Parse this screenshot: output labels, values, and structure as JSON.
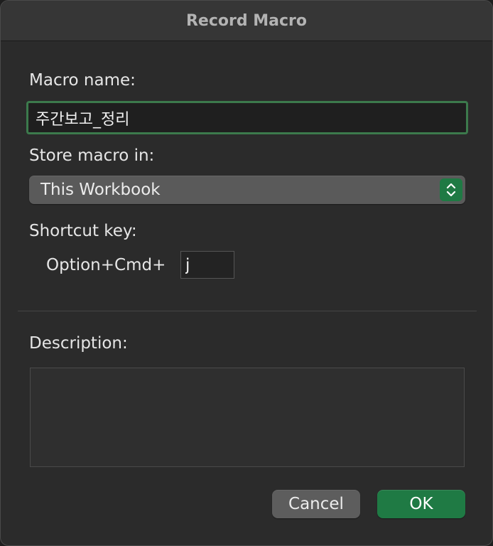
{
  "window": {
    "title": "Record Macro"
  },
  "form": {
    "macro_name_label": "Macro name:",
    "macro_name_value": "주간보고_정리",
    "store_label": "Store macro in:",
    "store_selected": "This Workbook",
    "shortcut_label": "Shortcut key:",
    "shortcut_prefix": "Option+Cmd+",
    "shortcut_value": "j",
    "description_label": "Description:",
    "description_value": ""
  },
  "buttons": {
    "cancel_label": "Cancel",
    "ok_label": "OK"
  },
  "colors": {
    "accent": "#1f7a44",
    "focus_ring": "#3c7a4c",
    "dialog_bg": "#2b2b2b"
  },
  "icons": {
    "stepper": "chevron-up-down-icon"
  }
}
